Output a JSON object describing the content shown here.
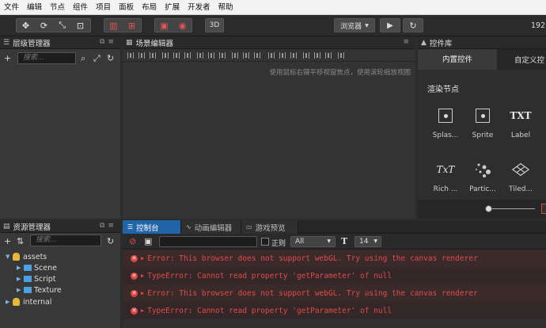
{
  "menu": [
    "文件",
    "编辑",
    "节点",
    "组件",
    "项目",
    "面板",
    "布局",
    "扩展",
    "开发者",
    "帮助"
  ],
  "toolbar": {
    "preview_label": "浏览器",
    "mode_3d": "3D",
    "ip_text": "192."
  },
  "hierarchy": {
    "title": "层级管理器",
    "search_placeholder": "搜索..."
  },
  "scene": {
    "title": "场景编辑器",
    "hint": "使用鼠标右键平移视窗焦点，使用滚轮缩放视图"
  },
  "library": {
    "title": "控件库",
    "tabs": [
      "内置控件",
      "自定义控"
    ],
    "section": "渲染节点",
    "items": [
      {
        "label": "Splas...",
        "icon": "splash-icon"
      },
      {
        "label": "Sprite",
        "icon": "sprite-icon"
      },
      {
        "label": "Label",
        "icon": "label-icon",
        "glyph": "TXT"
      },
      {
        "label": "Rich ...",
        "icon": "richtext-icon",
        "glyph": "TxT"
      },
      {
        "label": "Partic...",
        "icon": "particle-icon"
      },
      {
        "label": "Tiled...",
        "icon": "tiled-icon"
      }
    ]
  },
  "assets": {
    "title": "资源管理器",
    "search_placeholder": "搜索...",
    "tree": [
      {
        "label": "assets",
        "type": "db",
        "level": 0
      },
      {
        "label": "Scene",
        "type": "folder",
        "level": 1
      },
      {
        "label": "Script",
        "type": "folder",
        "level": 1
      },
      {
        "label": "Texture",
        "type": "folder",
        "level": 1
      },
      {
        "label": "internal",
        "type": "db",
        "level": 0
      }
    ]
  },
  "console": {
    "tabs": [
      "控制台",
      "动画编辑器",
      "游戏预览"
    ],
    "regex_label": "正则",
    "filter_value": "All",
    "font_size": "14",
    "logs": [
      "Error: This browser does not support webGL. Try using the canvas renderer",
      "TypeError: Cannot read property 'getParameter' of null",
      "Error: This browser does not support webGL. Try using the canvas renderer",
      "TypeError: Cannot read property 'getParameter' of null"
    ]
  },
  "colors": {
    "accent": "#2264a8",
    "error": "#e14b4b",
    "panel": "#383838"
  }
}
